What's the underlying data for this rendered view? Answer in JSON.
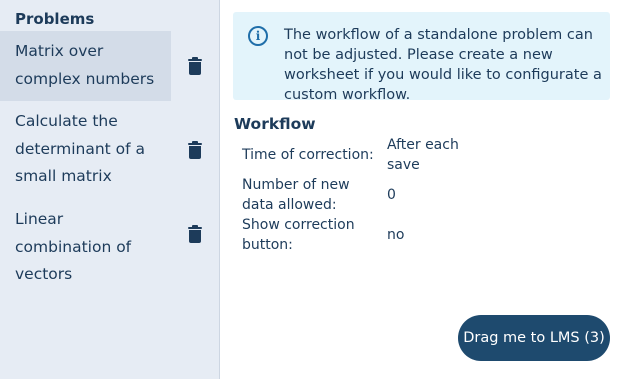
{
  "sidebar": {
    "title": "Problems",
    "items": [
      {
        "label": "Matrix over complex numbers",
        "active": true
      },
      {
        "label": "Calculate the determinant of a small matrix",
        "active": false
      },
      {
        "label": "Linear combination of vectors",
        "active": false
      }
    ],
    "delete_icon": "trash-icon"
  },
  "info": {
    "icon": "info-icon",
    "icon_glyph": "i",
    "text": "The workflow of a standalone problem can not be adjusted. Please create a new worksheet if you would like to configurate a custom workflow."
  },
  "workflow": {
    "title": "Workflow",
    "rows": [
      {
        "label": "Time of correction:",
        "value": "After each save"
      },
      {
        "label": "Number of new data allowed:",
        "value": "0"
      },
      {
        "label": "Show correction button:",
        "value": "no"
      }
    ]
  },
  "drag_button": {
    "label": "Drag me to LMS",
    "count": "(3)"
  },
  "colors": {
    "sidebar_bg": "#e6ecf4",
    "active_item_bg": "#d3dce8",
    "info_bg": "#e3f4fb",
    "text": "#1d3b5a",
    "button_bg": "#1e4a6e"
  }
}
